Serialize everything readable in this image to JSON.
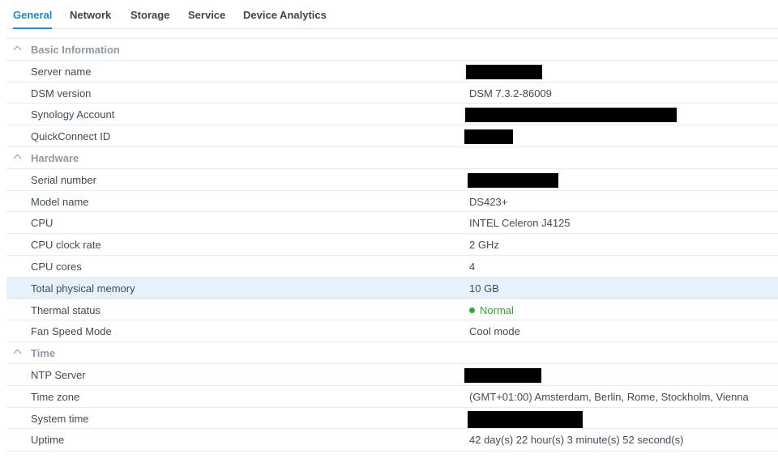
{
  "tabs": [
    {
      "label": "General"
    },
    {
      "label": "Network"
    },
    {
      "label": "Storage"
    },
    {
      "label": "Service"
    },
    {
      "label": "Device Analytics"
    }
  ],
  "basic": {
    "title": "Basic Information",
    "server_name_label": "Server name",
    "dsm_version_label": "DSM version",
    "dsm_version_value": "DSM 7.3.2-86009",
    "synology_account_label": "Synology Account",
    "quickconnect_label": "QuickConnect ID"
  },
  "hardware": {
    "title": "Hardware",
    "serial_label": "Serial number",
    "model_label": "Model name",
    "model_value": "DS423+",
    "cpu_label": "CPU",
    "cpu_value": "INTEL Celeron J4125",
    "clock_label": "CPU clock rate",
    "clock_value": "2 GHz",
    "cores_label": "CPU cores",
    "cores_value": "4",
    "memory_label": "Total physical memory",
    "memory_value": "10 GB",
    "thermal_label": "Thermal status",
    "thermal_value": "Normal",
    "fan_label": "Fan Speed Mode",
    "fan_value": "Cool mode"
  },
  "time": {
    "title": "Time",
    "ntp_label": "NTP Server",
    "timezone_label": "Time zone",
    "timezone_value": "(GMT+01:00) Amsterdam, Berlin, Rome, Stockholm, Vienna",
    "system_time_label": "System time",
    "uptime_label": "Uptime",
    "uptime_value": "42 day(s) 22 hour(s) 3 minute(s) 52 second(s)"
  },
  "colors": {
    "accent": "#1b8ad2",
    "status_normal": "#2ea82e",
    "row_highlight": "#e8f1fb"
  }
}
